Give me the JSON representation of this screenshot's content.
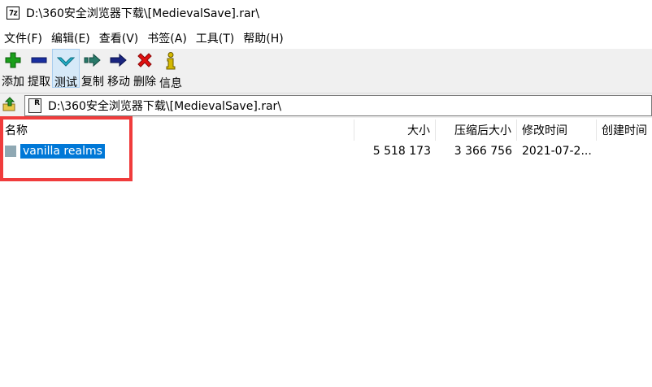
{
  "window": {
    "title": "D:\\360安全浏览器下载\\[MedievalSave].rar\\",
    "app_icon_text": "7z"
  },
  "menu": {
    "items": [
      "文件(F)",
      "编辑(E)",
      "查看(V)",
      "书签(A)",
      "工具(T)",
      "帮助(H)"
    ]
  },
  "toolbar": {
    "add_label": "添加",
    "extract_label": "提取",
    "test_label": "测试",
    "copy_label": "复制",
    "move_label": "移动",
    "delete_label": "删除",
    "info_label": "信息",
    "icons": [
      "plus-icon",
      "minus-icon",
      "check-icon",
      "copy-arrow-icon",
      "move-arrow-icon",
      "delete-x-icon",
      "info-icon"
    ],
    "colors": {
      "add": "#1a9e1a",
      "extract": "#1a2fa0",
      "test": "#23b0c9",
      "copy": "#2a7a6a",
      "move": "#1a2580",
      "delete": "#e01010",
      "info": "#d4b800"
    }
  },
  "address": {
    "path": "D:\\360安全浏览器下载\\[MedievalSave].rar\\",
    "icon_text": "R"
  },
  "columns": {
    "name": "名称",
    "size": "大小",
    "packed": "压缩后大小",
    "modified": "修改时间",
    "created": "创建时间"
  },
  "files": [
    {
      "name": "vanilla realms",
      "size": "5 518 173",
      "packed": "3 366 756",
      "modified": "2021-07-2...",
      "selected": true
    }
  ],
  "accent": {
    "selection": "#0078d7",
    "annotation": "#f03c3c"
  }
}
